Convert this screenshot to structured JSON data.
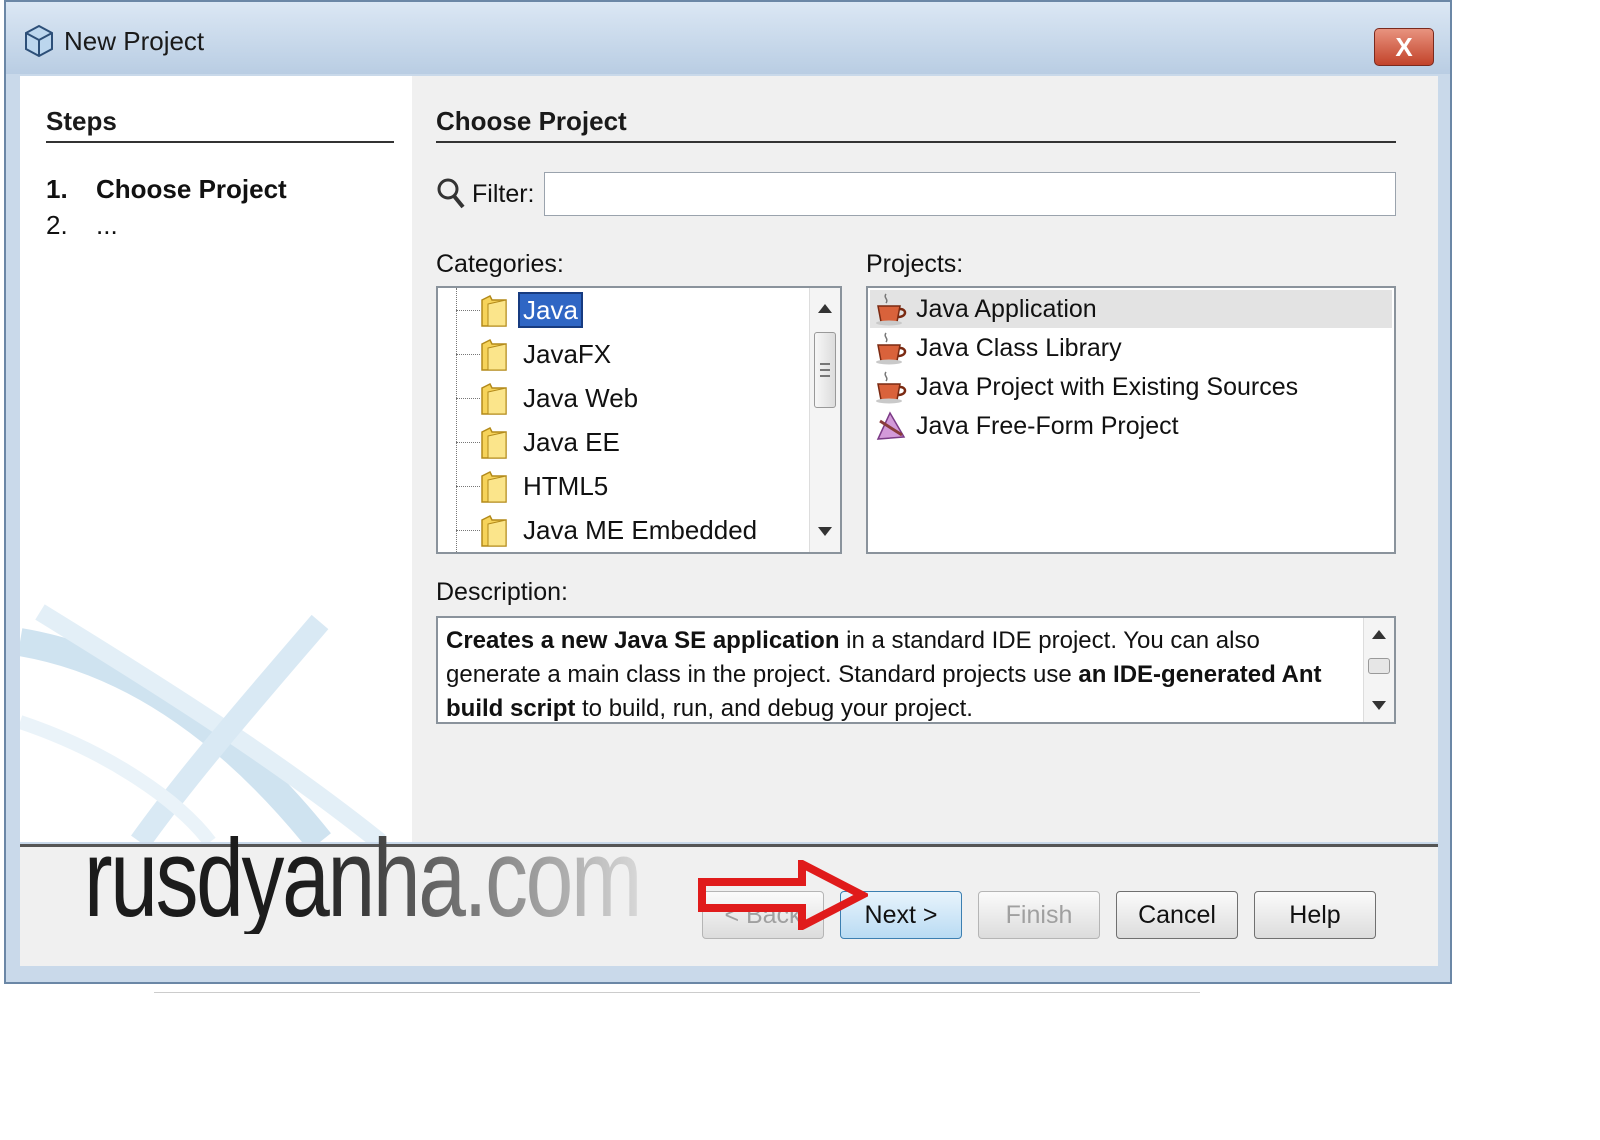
{
  "window": {
    "title": "New Project",
    "close_label": "X"
  },
  "steps": {
    "title": "Steps",
    "items": [
      {
        "num": "1.",
        "label": "Choose Project"
      },
      {
        "num": "2.",
        "label": "..."
      }
    ]
  },
  "main": {
    "title": "Choose Project",
    "filter": {
      "label": "Filter:",
      "value": ""
    },
    "categories_label": "Categories:",
    "categories": [
      "Java",
      "JavaFX",
      "Java Web",
      "Java EE",
      "HTML5",
      "Java ME Embedded"
    ],
    "selected_category": "Java",
    "projects_label": "Projects:",
    "projects": [
      {
        "label": "Java Application",
        "icon": "coffee-cup-icon"
      },
      {
        "label": "Java Class Library",
        "icon": "coffee-cup-icon"
      },
      {
        "label": "Java Project with Existing Sources",
        "icon": "coffee-cup-icon"
      },
      {
        "label": "Java Free-Form Project",
        "icon": "free-form-project-icon"
      }
    ],
    "selected_project": "Java Application",
    "description_label": "Description:",
    "description": {
      "part1_bold": "Creates a new Java SE application",
      "part2": " in a standard IDE project. You can also generate a main class in the project. Standard projects use ",
      "part3_bold": "an IDE-generated Ant build script",
      "part4": " to build, run, and debug your project."
    }
  },
  "footer": {
    "back_label": "< Back",
    "next_label": "Next >",
    "finish_label": "Finish",
    "cancel_label": "Cancel",
    "help_label": "Help"
  },
  "watermark": "rusdyanha.com",
  "colors": {
    "selection": "#2f66c4",
    "arrow": "#e01b1b",
    "title_bar": "#c9d9ea"
  }
}
